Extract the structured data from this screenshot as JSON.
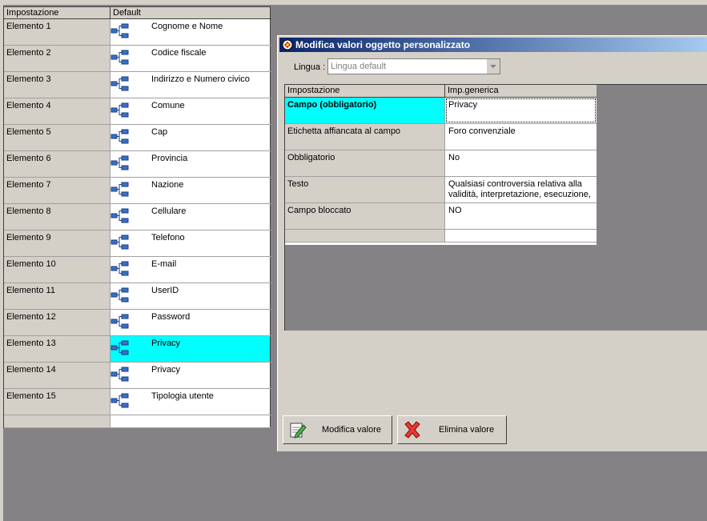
{
  "left_grid": {
    "headers": [
      "Impostazione",
      "Default"
    ],
    "rows": [
      {
        "label": "Elemento 1",
        "value": "Cognome e Nome"
      },
      {
        "label": "Elemento 2",
        "value": "Codice fiscale"
      },
      {
        "label": "Elemento 3",
        "value": "Indirizzo e Numero civico"
      },
      {
        "label": "Elemento 4",
        "value": "Comune"
      },
      {
        "label": "Elemento 5",
        "value": "Cap"
      },
      {
        "label": "Elemento 6",
        "value": "Provincia"
      },
      {
        "label": "Elemento 7",
        "value": "Nazione"
      },
      {
        "label": "Elemento 8",
        "value": "Cellulare"
      },
      {
        "label": "Elemento 9",
        "value": "Telefono"
      },
      {
        "label": "Elemento 10",
        "value": "E-mail"
      },
      {
        "label": "Elemento 11",
        "value": "UserID"
      },
      {
        "label": "Elemento 12",
        "value": "Password"
      },
      {
        "label": "Elemento 13",
        "value": "Privacy"
      },
      {
        "label": "Elemento 14",
        "value": "Privacy"
      },
      {
        "label": "Elemento 15",
        "value": "Tipologia utente"
      }
    ],
    "selected_index": 12,
    "row_icon": "tree-node-icon"
  },
  "dialog": {
    "title": "Modifica valori oggetto personalizzato",
    "title_icon": "app-icon",
    "lingua_label": "Lingua :",
    "lingua_value": "Lingua default",
    "grid": {
      "headers": [
        "Impostazione",
        "Imp.generica"
      ],
      "rows": [
        {
          "label": "Campo (obbligatorio)",
          "value": "Privacy"
        },
        {
          "label": "Etichetta affiancata al campo",
          "value": "Foro convenziale"
        },
        {
          "label": "Obbligatorio",
          "value": "No"
        },
        {
          "label": "Testo",
          "value": "Qualsiasi controversia relativa alla validità, interpretazione, esecuzione,"
        },
        {
          "label": "Campo bloccato",
          "value": "NO"
        }
      ]
    },
    "buttons": {
      "modifica": "Modifica valore",
      "elimina": "Elimina valore"
    }
  },
  "colors": {
    "selection": "#00ffff",
    "background": "#848284",
    "face": "#d4d0c8"
  }
}
